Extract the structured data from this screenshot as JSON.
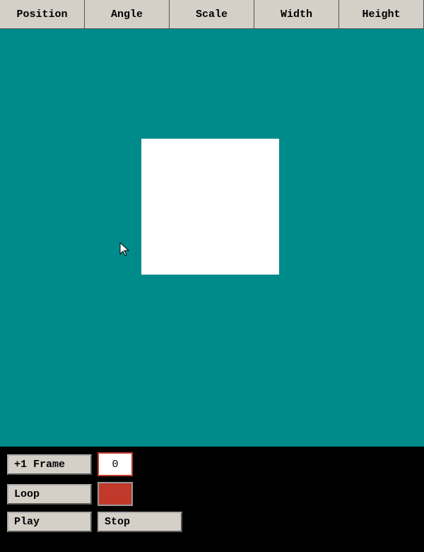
{
  "header": {
    "tabs": [
      {
        "label": "Position",
        "id": "position"
      },
      {
        "label": "Angle",
        "id": "angle"
      },
      {
        "label": "Scale",
        "id": "scale"
      },
      {
        "label": "Width",
        "id": "width"
      },
      {
        "label": "Height",
        "id": "height"
      }
    ]
  },
  "controls": {
    "frame_button_label": "+1 Frame",
    "frame_value": "0",
    "loop_label": "Loop",
    "play_label": "Play",
    "stop_label": "Stop",
    "swatch_color": "#c0392b"
  }
}
